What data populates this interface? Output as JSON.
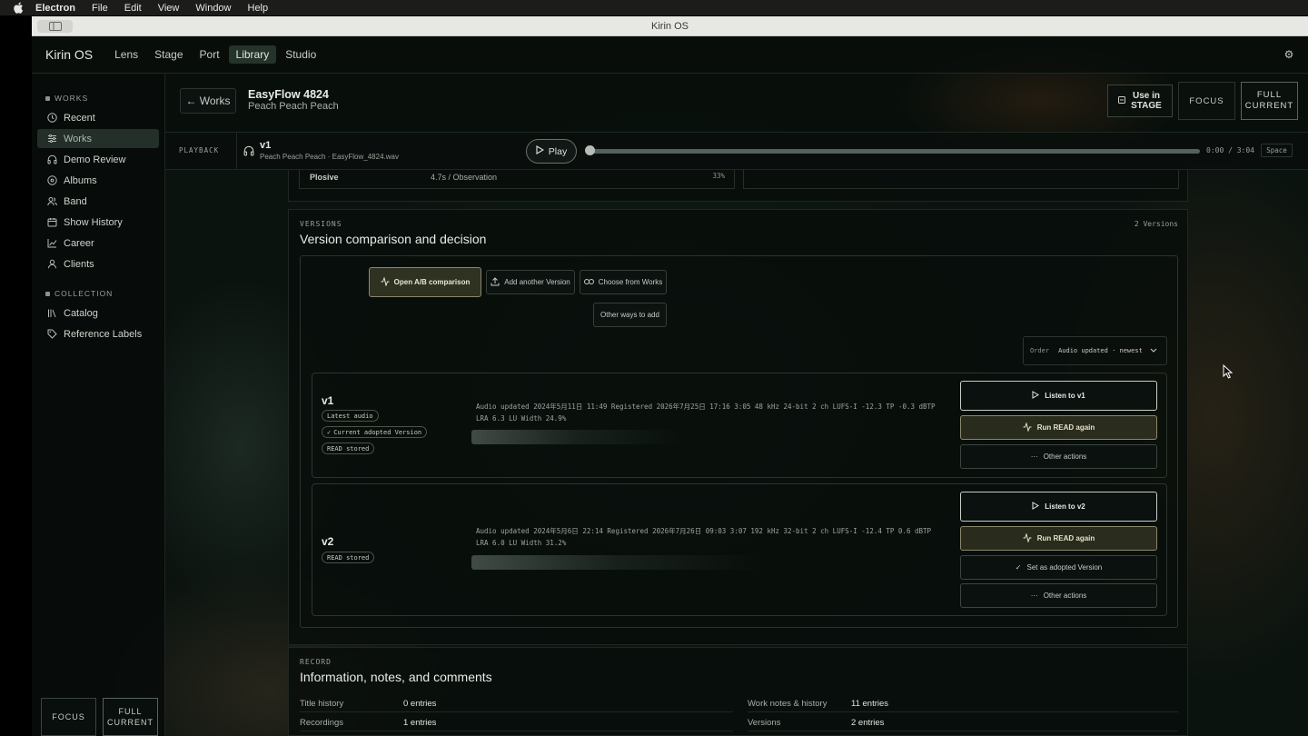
{
  "menubar": {
    "app": "Electron",
    "items": [
      "File",
      "Edit",
      "View",
      "Window",
      "Help"
    ]
  },
  "window": {
    "title": "Kirin OS"
  },
  "topnav": {
    "brand": "Kirin OS",
    "tabs": [
      "Lens",
      "Stage",
      "Port",
      "Library",
      "Studio"
    ],
    "active_tab": "Library"
  },
  "sidebar": {
    "works_heading": "WORKS",
    "works_items": [
      "Recent",
      "Works",
      "Demo Review",
      "Albums",
      "Band",
      "Show History",
      "Career",
      "Clients"
    ],
    "active_item": "Works",
    "collection_heading": "COLLECTION",
    "collection_items": [
      "Catalog",
      "Reference Labels"
    ],
    "footer": {
      "focus": "FOCUS",
      "full_line1": "FULL",
      "full_line2": "CURRENT"
    }
  },
  "header": {
    "back_label": "← Works",
    "title": "EasyFlow 4824",
    "subtitle": "Peach Peach Peach",
    "use_in_line1": "Use in",
    "use_in_line2": "STAGE",
    "focus": "FOCUS",
    "full_line1": "FULL",
    "full_line2": "CURRENT"
  },
  "playback": {
    "label": "PLAYBACK",
    "track_title": "v1",
    "track_sub": "Peach Peach Peach · EasyFlow_4824.wav",
    "play_label": "Play",
    "time": "0:00 / 3:04",
    "progress": 0.0,
    "shortcut": "Space"
  },
  "plosive": {
    "name": "Plosive",
    "detail": "4.7s / Observation",
    "percent": "33%"
  },
  "versions": {
    "label": "VERSIONS",
    "title": "Version comparison and decision",
    "count": "2 Versions",
    "open_ab": "Open A/B comparison",
    "add_another": "Add another Version",
    "choose_from": "Choose from Works",
    "other_ways": "Other ways to add",
    "order_label": "Order",
    "order_value": "Audio updated · newest",
    "v1": {
      "name": "v1",
      "badges": [
        "Latest audio",
        "Current adopted Version",
        "READ stored"
      ],
      "meta_line1": "Audio updated 2024年5月11日 11:49  Registered 2026年7月25日 17:16  3:05  48 kHz  24-bit  2 ch  LUFS-I -12.3  TP -0.3 dBTP",
      "meta_line2": "LRA 6.3 LU  Width 24.9%",
      "listen": "Listen to v1",
      "run_read": "Run READ again",
      "other": "Other actions"
    },
    "v2": {
      "name": "v2",
      "badges": [
        "READ stored"
      ],
      "meta_line1": "Audio updated 2024年5月6日 22:14  Registered 2026年7月26日 09:03  3:07  192 kHz  32-bit  2 ch  LUFS-I -12.4  TP 0.6 dBTP",
      "meta_line2": "LRA 6.0 LU  Width 31.2%",
      "listen": "Listen to v2",
      "run_read": "Run READ again",
      "set_adopted": "Set as adopted Version",
      "other": "Other actions"
    }
  },
  "record": {
    "label": "RECORD",
    "title": "Information, notes, and comments",
    "left_rows": [
      {
        "k": "Title history",
        "v": "0 entries"
      },
      {
        "k": "Recordings",
        "v": "1 entries"
      }
    ],
    "right_rows": [
      {
        "k": "Work notes & history",
        "v": "11 entries"
      },
      {
        "k": "Versions",
        "v": "2 entries"
      }
    ]
  }
}
